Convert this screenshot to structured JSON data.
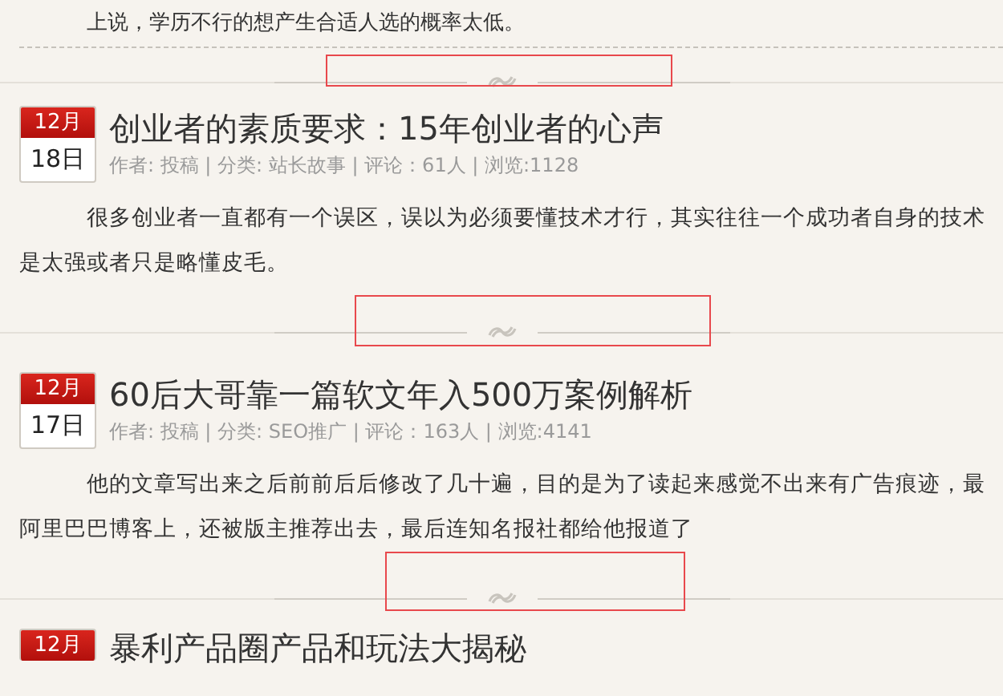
{
  "intro": {
    "text": "上说，学历不行的想产生合适人选的概率太低。"
  },
  "posts": [
    {
      "month": "12月",
      "day": "18日",
      "title": "创业者的素质要求：15年创业者的心声",
      "meta": "作者: 投稿 | 分类: 站长故事 | 评论：61人 | 浏览:1128",
      "lines": [
        "很多创业者一直都有一个误区，误以为必须要懂技术才行，其实往往一个成功者自身的技术",
        "是太强或者只是略懂皮毛。"
      ],
      "highlighted": true
    },
    {
      "month": "12月",
      "day": "17日",
      "title": "60后大哥靠一篇软文年入500万案例解析",
      "meta": "作者: 投稿 | 分类: SEO推广 | 评论：163人 | 浏览:4141",
      "lines": [
        "他的文章写出来之后前前后后修改了几十遍，目的是为了读起来感觉不出来有广告痕迹，最",
        "阿里巴巴博客上，还被版主推荐出去，最后连知名报社都给他报道了"
      ],
      "highlighted": true
    },
    {
      "month": "12月",
      "title": "暴利产品圈产品和玩法大揭秘"
    }
  ],
  "first_divider": {
    "highlighted": true
  }
}
